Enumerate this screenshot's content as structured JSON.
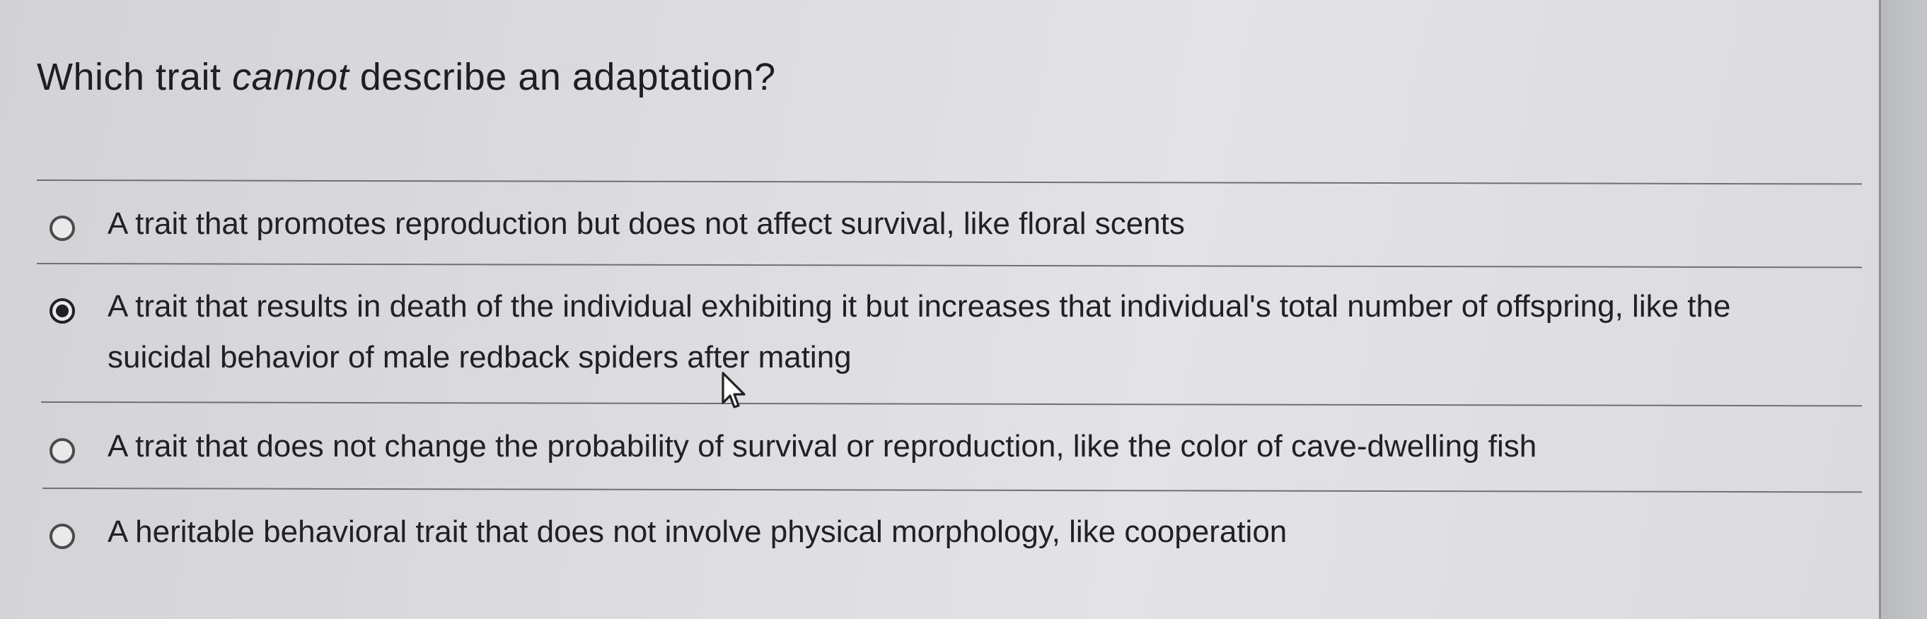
{
  "question": {
    "prefix": "Which trait ",
    "emphasis": "cannot",
    "suffix": " describe an adaptation?"
  },
  "options": [
    {
      "label": "A trait that promotes reproduction but does not affect survival, like floral scents",
      "selected": false
    },
    {
      "label_line1": "A trait that results in death of the individual exhibiting it but increases that individual's total number of offspring, like the",
      "label_line2": "suicidal behavior of male redback spiders after mating",
      "selected": true
    },
    {
      "label": "A trait that does not change the probability of survival or reproduction, like the color of cave-dwelling fish",
      "selected": false
    },
    {
      "label": "A heritable behavioral trait that does not involve physical morphology, like cooperation",
      "selected": false
    }
  ],
  "colors": {
    "text": "#202124",
    "divider": "#6f7074",
    "background": "#dcdcde"
  },
  "icons": {
    "cursor": "mouse-pointer-icon"
  }
}
